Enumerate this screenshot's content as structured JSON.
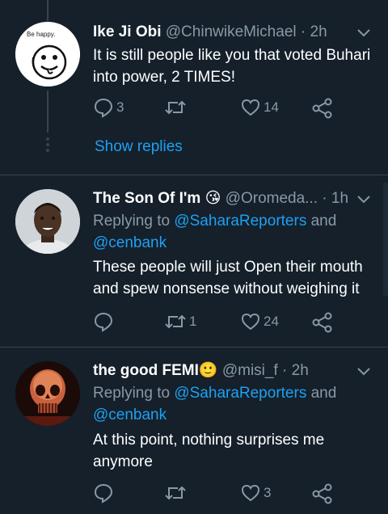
{
  "tweets": [
    {
      "name": "Ike Ji Obi",
      "handle": "@ChinwikeMichael",
      "time": "2h",
      "avatar_text": "Be happy.",
      "text": "It is still people like you that voted Buhari into power, 2 TIMES!",
      "replies": "3",
      "retweets": "",
      "likes": "14",
      "show_replies": "Show replies"
    },
    {
      "name": "The Son Of I'm",
      "emoji": "😘",
      "handle": "@Oromeda...",
      "time": "1h",
      "replying_prefix": "Replying to ",
      "reply_mention_1": "@SaharaReporters",
      "reply_and": " and",
      "reply_mention_2": "@cenbank",
      "text": "These people will just Open their mouth and spew nonsense without weighing it",
      "replies": "",
      "retweets": "1",
      "likes": "24"
    },
    {
      "name": "the good FEMI",
      "emoji": "🙂",
      "handle": "@misi_f",
      "time": "2h",
      "replying_prefix": "Replying to ",
      "reply_mention_1": "@SaharaReporters",
      "reply_and": " and",
      "reply_mention_2": "@cenbank",
      "text": "At this point, nothing surprises me anymore",
      "replies": "",
      "retweets": "",
      "likes": "3"
    }
  ],
  "colors": {
    "background": "#15202b",
    "secondary_text": "#8899a6",
    "link": "#1da1f2",
    "divider": "#38444d"
  }
}
